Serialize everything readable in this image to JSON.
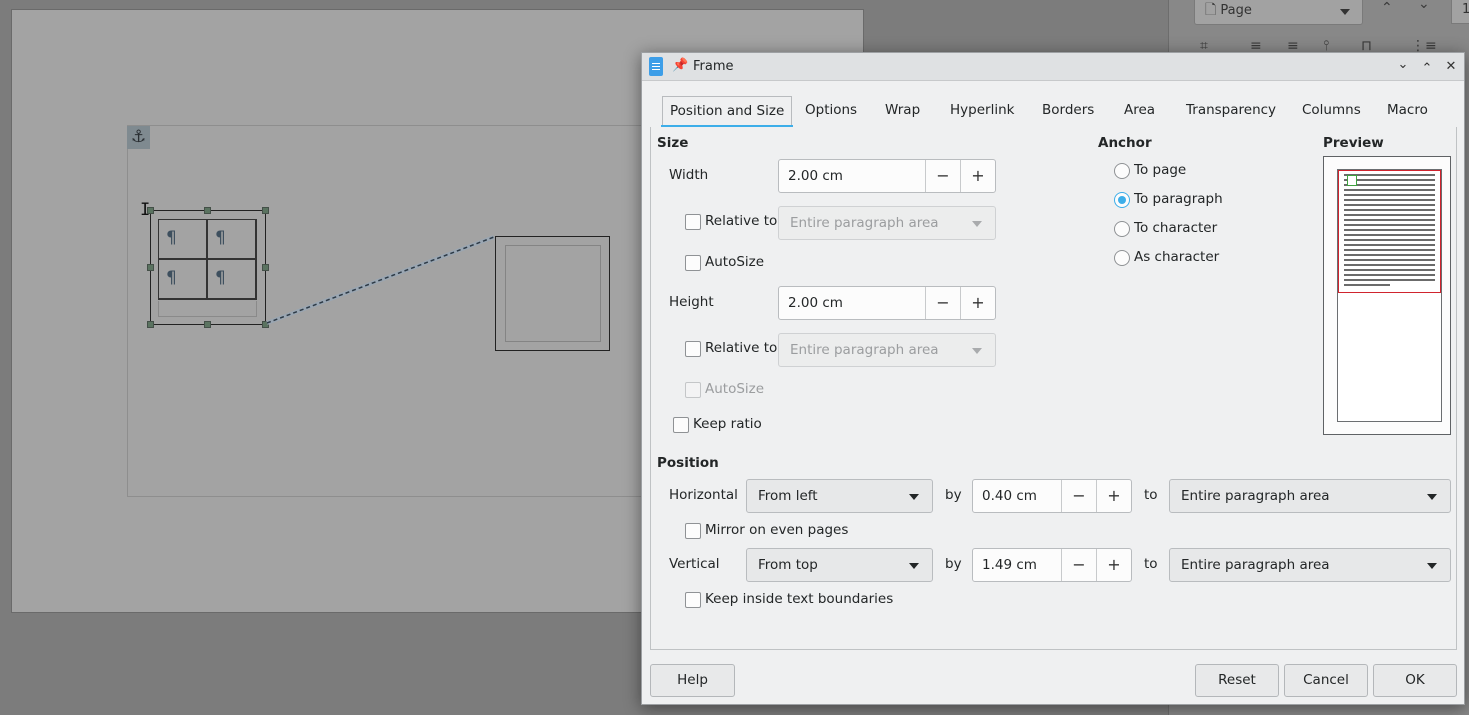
{
  "background": {
    "pilcrow": "¶",
    "anchor_glyph": "⚓",
    "cursor_glyph": "I",
    "sidebar": {
      "page_combo": "Page",
      "page_number": "1"
    }
  },
  "dialog": {
    "title": "Frame",
    "tabs": [
      {
        "label": "Position and Size",
        "active": true
      },
      {
        "label": "Options"
      },
      {
        "label": "Wrap"
      },
      {
        "label": "Hyperlink"
      },
      {
        "label": "Borders"
      },
      {
        "label": "Area"
      },
      {
        "label": "Transparency"
      },
      {
        "label": "Columns"
      },
      {
        "label": "Macro"
      }
    ],
    "size": {
      "heading": "Size",
      "width_label": "Width",
      "width_value": "2.00 cm",
      "relative_to_label": "Relative to",
      "relative_to_value": "Entire paragraph area",
      "autosize_label": "AutoSize",
      "height_label": "Height",
      "height_value": "2.00 cm",
      "height_relative_to_label": "Relative to",
      "height_relative_to_value": "Entire paragraph area",
      "height_autosize_label": "AutoSize",
      "keep_ratio_label": "Keep ratio"
    },
    "anchor": {
      "heading": "Anchor",
      "options": [
        {
          "label": "To page",
          "checked": false
        },
        {
          "label": "To paragraph",
          "checked": true
        },
        {
          "label": "To character",
          "checked": false
        },
        {
          "label": "As character",
          "checked": false
        }
      ]
    },
    "preview": {
      "heading": "Preview"
    },
    "position": {
      "heading": "Position",
      "horizontal_label": "Horizontal",
      "horizontal_mode": "From left",
      "by_label": "by",
      "horizontal_by": "0.40 cm",
      "to_label": "to",
      "horizontal_to": "Entire paragraph area",
      "mirror_label": "Mirror on even pages",
      "vertical_label": "Vertical",
      "vertical_mode": "From top",
      "vertical_by_label": "by",
      "vertical_by": "1.49 cm",
      "vertical_to_label": "to",
      "vertical_to": "Entire paragraph area",
      "keep_inside_label": "Keep inside text boundaries"
    },
    "buttons": {
      "help": "Help",
      "reset": "Reset",
      "cancel": "Cancel",
      "ok": "OK"
    },
    "glyphs": {
      "minus": "−",
      "plus": "+",
      "pin": "📌",
      "minimize": "⌄",
      "maximize": "⌃",
      "close": "✕"
    },
    "colors": {
      "accent": "#3daee9",
      "preview_area": "#d0242e",
      "preview_frame": "#3fa23f"
    }
  }
}
